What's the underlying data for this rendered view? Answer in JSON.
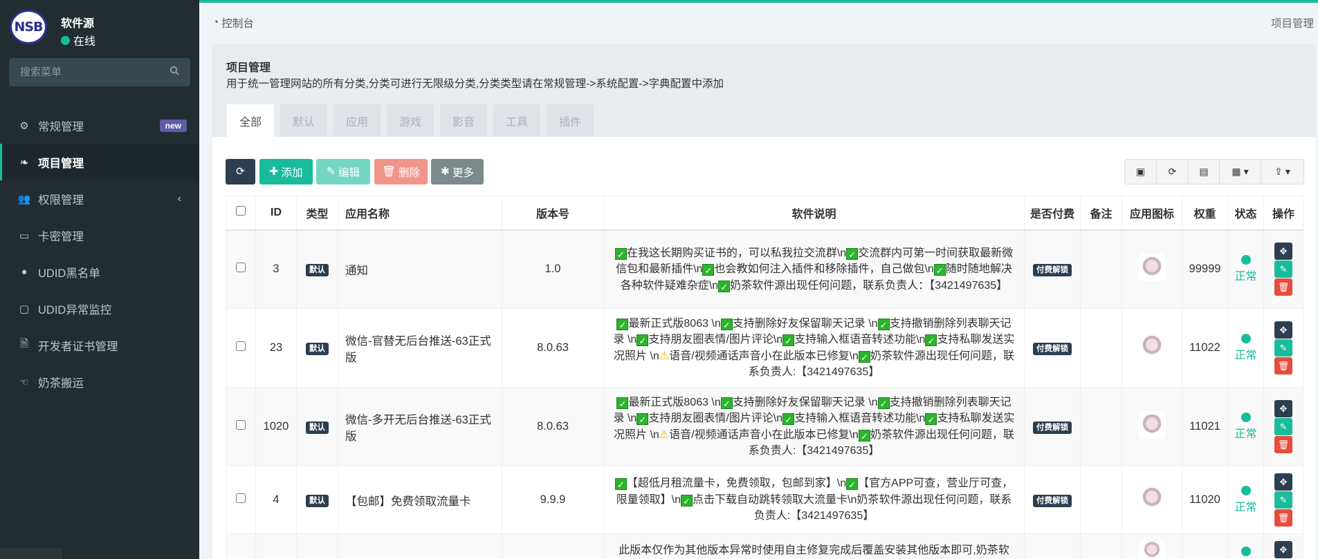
{
  "sidebar": {
    "logo_text": "NSB",
    "user_name": "软件源",
    "user_status": "在线",
    "search_placeholder": "搜索菜单",
    "items": [
      {
        "label": "常规管理",
        "badge": "new"
      },
      {
        "label": "项目管理"
      },
      {
        "label": "权限管理"
      },
      {
        "label": "卡密管理"
      },
      {
        "label": "UDID黑名单"
      },
      {
        "label": "UDID异常监控"
      },
      {
        "label": "开发者证书管理"
      },
      {
        "label": "奶茶搬运"
      }
    ]
  },
  "header": {
    "breadcrumb": "控制台",
    "right_title": "项目管理"
  },
  "panel": {
    "title": "项目管理",
    "description": "用于统一管理网站的所有分类,分类可进行无限级分类,分类类型请在常规管理->系统配置->字典配置中添加",
    "tabs": [
      "全部",
      "默认",
      "应用",
      "游戏",
      "影音",
      "工具",
      "插件"
    ]
  },
  "toolbar": {
    "add": "添加",
    "edit": "编辑",
    "delete": "删除",
    "more": "更多"
  },
  "colors": {
    "accent": "#18bc9c",
    "dark": "#2c3e50",
    "danger": "#e74c3c",
    "sidebar": "#222d32"
  },
  "table": {
    "headers": [
      "ID",
      "类型",
      "应用名称",
      "版本号",
      "软件说明",
      "是否付费",
      "备注",
      "应用图标",
      "权重",
      "状态",
      "操作"
    ],
    "rows": [
      {
        "id": "3",
        "type": "默认",
        "name": "通知",
        "version": "1.0",
        "desc": "✅在我这长期购买证书的，可以私我拉交流群\\n✅交流群内可第一时间获取最新微信包和最新插件\\n✅也会教如何注入插件和移除插件，自己做包\\n✅随时随地解决各种软件疑难杂症\\n✅奶茶软件源出现任何问题，联系负责人：【3421497635】",
        "paid": "付费解锁",
        "note": "",
        "weight": "99999",
        "status": "正常"
      },
      {
        "id": "23",
        "type": "默认",
        "name": "微信-官替无后台推送-63正式版",
        "version": "8.0.63",
        "desc": "✅最新正式版8063 \\n✅支持删除好友保留聊天记录 \\n✅支持撤销删除列表聊天记录 \\n✅支持朋友圈表情/图片评论\\n✅支持输入框语音转述功能\\n✅支持私聊发送实况照片 \\n⚠️语音/视频通话声音小在此版本已修复\\n✅奶茶软件源出现任何问题，联系负责人:【3421497635】",
        "paid": "付费解锁",
        "note": "",
        "weight": "11022",
        "status": "正常"
      },
      {
        "id": "1020",
        "type": "默认",
        "name": "微信-多开无后台推送-63正式版",
        "version": "8.0.63",
        "desc": "✅最新正式版8063 \\n✅支持删除好友保留聊天记录 \\n✅支持撤销删除列表聊天记录 \\n✅支持朋友圈表情/图片评论\\n✅支持输入框语音转述功能\\n✅支持私聊发送实况照片 \\n⚠️语音/视频通话声音小在此版本已修复\\n✅奶茶软件源出现任何问题，联系负责人:【3421497635】",
        "paid": "付费解锁",
        "note": "",
        "weight": "11021",
        "status": "正常"
      },
      {
        "id": "4",
        "type": "默认",
        "name": "【包邮】免费领取流量卡",
        "version": "9.9.9",
        "desc": "✅【超低月租流量卡，免费领取，包邮到家】\\n✅【官方APP可查，营业厅可查，限量领取】\\n✅点击下载自动跳转领取大流量卡\\n奶茶软件源出现任何问题，联系负责人:【3421497635】",
        "paid": "付费解锁",
        "note": "",
        "weight": "11020",
        "status": "正常"
      },
      {
        "desc": "此版本仅作为其他版本异常时使用自主修复完成后覆盖安装其他版本即可,奶茶软"
      }
    ]
  }
}
